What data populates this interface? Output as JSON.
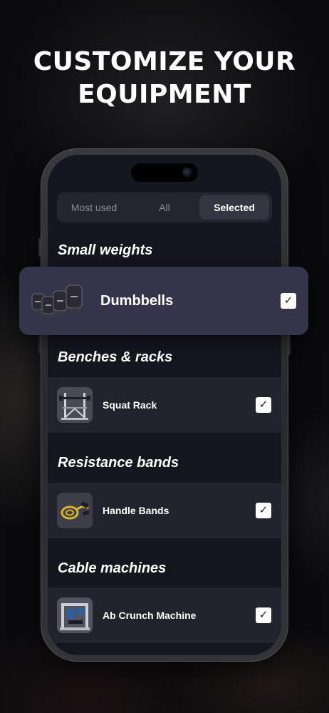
{
  "headline": {
    "line1": "CUSTOMIZE YOUR",
    "line2": "EQUIPMENT"
  },
  "tabs": [
    {
      "label": "Most used",
      "active": false
    },
    {
      "label": "All",
      "active": false
    },
    {
      "label": "Selected",
      "active": true
    }
  ],
  "sections": [
    {
      "title": "Small weights",
      "items": [
        {
          "label": "Dumbbells",
          "checked": true,
          "icon": "dumbbells-icon",
          "highlighted": true
        }
      ]
    },
    {
      "title": "Benches & racks",
      "items": [
        {
          "label": "Squat Rack",
          "checked": true,
          "icon": "squat-rack-icon"
        }
      ]
    },
    {
      "title": "Resistance bands",
      "items": [
        {
          "label": "Handle Bands",
          "checked": true,
          "icon": "handle-bands-icon"
        }
      ]
    },
    {
      "title": "Cable machines",
      "items": [
        {
          "label": "Ab Crunch Machine",
          "checked": true,
          "icon": "ab-crunch-machine-icon"
        }
      ]
    }
  ],
  "checkmark_glyph": "✓",
  "colors": {
    "background": "#0b0b0d",
    "screen": "#16161e",
    "row": "#23232e",
    "highlight_card": "#34344a",
    "tab_active": "#363642",
    "checkbox": "#ffffff"
  }
}
